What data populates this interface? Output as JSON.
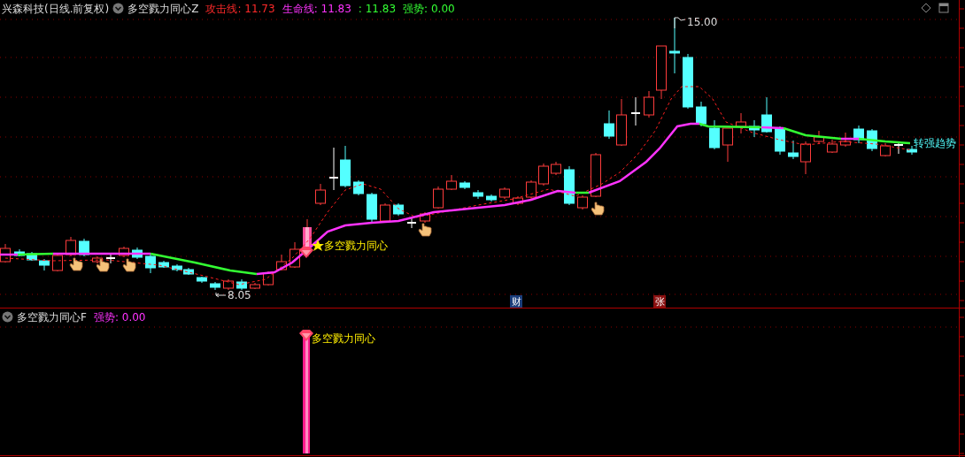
{
  "header": {
    "title": "兴森科技(日线.前复权)",
    "indicator": "多空戮力同心Z",
    "values": [
      {
        "text": "攻击线: 11.73",
        "color": "#ff2a2a"
      },
      {
        "text": "生命线: 11.83",
        "color": "#ff33ff"
      },
      {
        "text": ": 11.83",
        "color": "#33ff33"
      },
      {
        "text": "强势: 0.00",
        "color": "#33ff33"
      }
    ]
  },
  "main_chart": {
    "high_label": "15.00",
    "low_label": "8.05",
    "signal_label": "多空戮力同心",
    "trend_label": "转强趋势",
    "markers": [
      {
        "text": "财",
        "kind": "finance"
      },
      {
        "text": "张",
        "kind": "limit"
      }
    ]
  },
  "sub_panel": {
    "indicator": "多空戮力同心F",
    "values": [
      {
        "text": "强势: 0.00",
        "color": "#ff33ff"
      }
    ],
    "signal_label": "多空戮力同心"
  }
}
